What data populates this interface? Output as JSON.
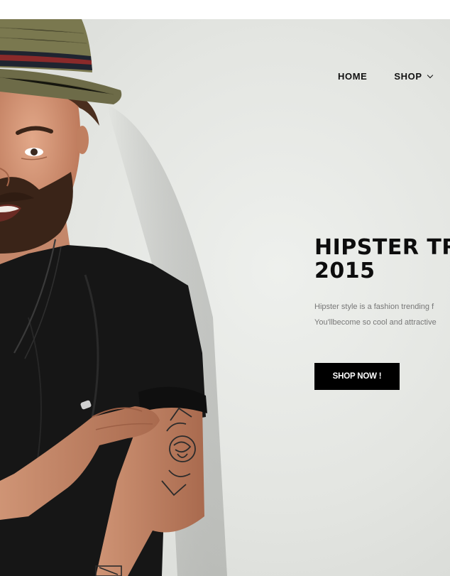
{
  "nav": {
    "items": [
      {
        "label": "HOME"
      },
      {
        "label": "SHOP",
        "icon": "chevron-down-icon"
      }
    ]
  },
  "hero": {
    "title_line1": "HIPSTER TR",
    "title_line2": "2015",
    "desc_line1": "Hipster style is a fashion trending f",
    "desc_line2": "You'llbecome so cool and attractive",
    "cta_label": "SHOP NOW !",
    "image": "man-with-hat-and-tattoo-photo"
  },
  "colors": {
    "background": "#e4e6e2",
    "text": "#111111",
    "muted_text": "#777777",
    "button_bg": "#000000",
    "button_text": "#ffffff"
  }
}
